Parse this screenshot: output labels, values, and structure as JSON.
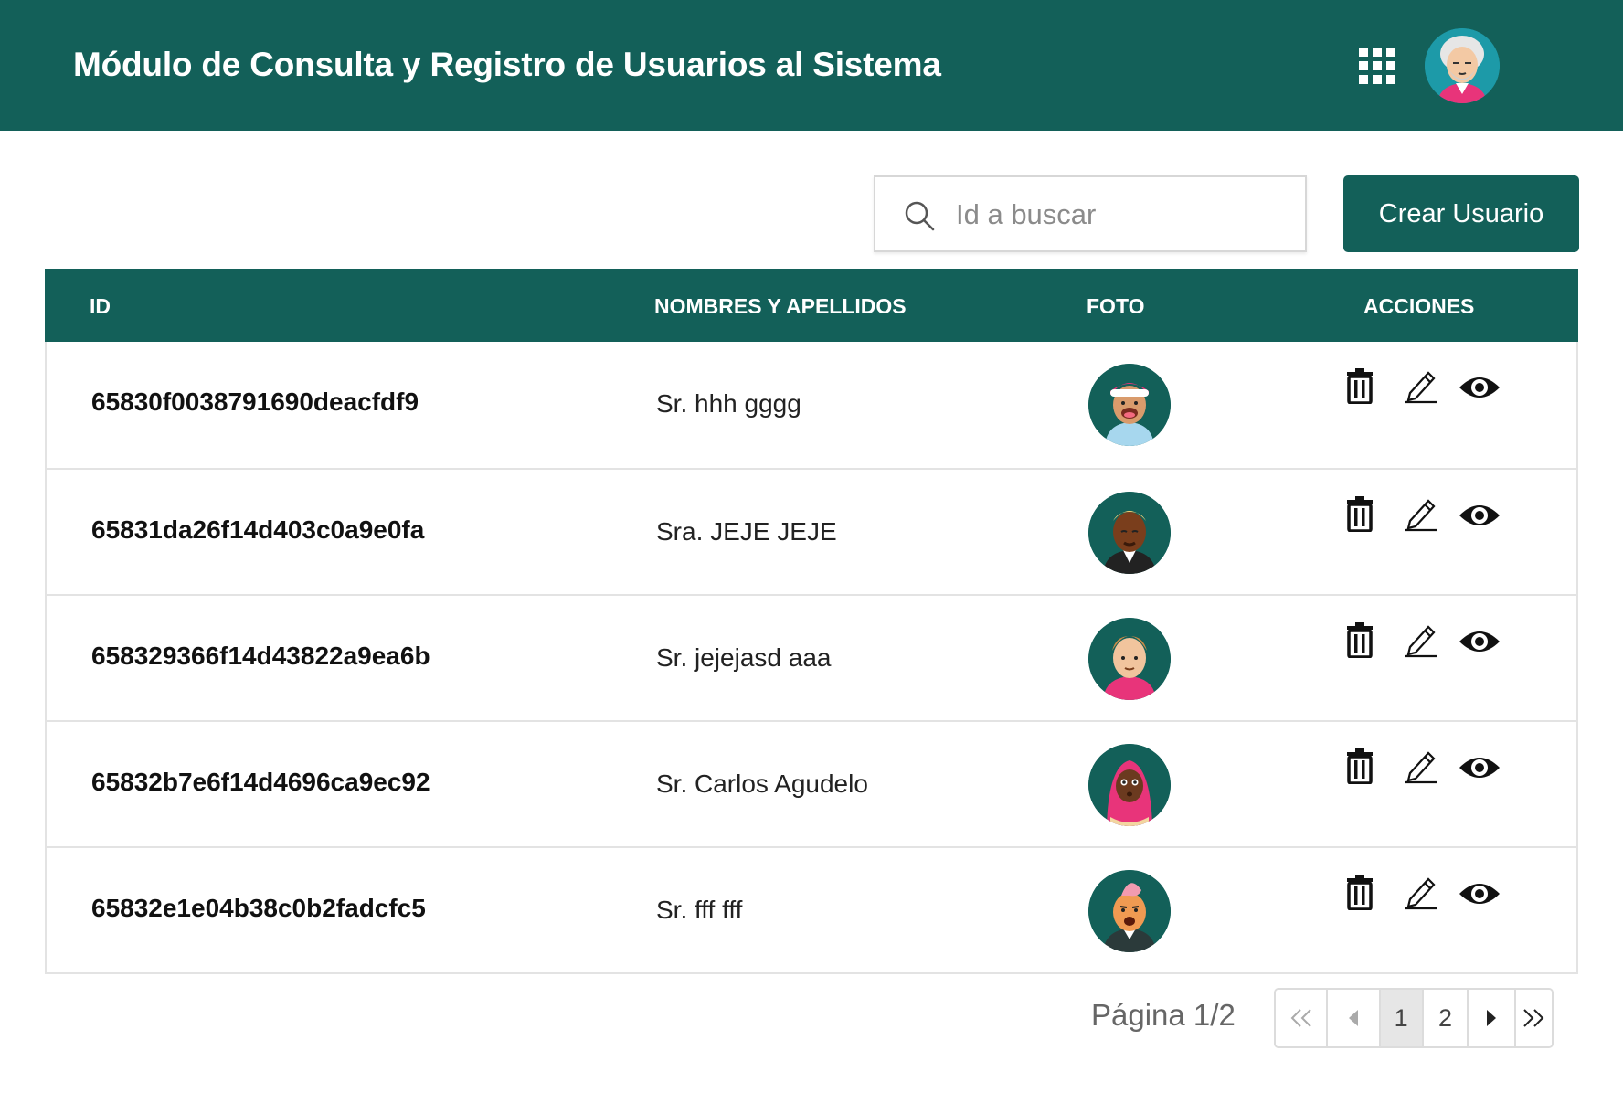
{
  "header": {
    "title": "Módulo de Consulta y Registro de Usuarios al Sistema",
    "apps_icon": "grid-apps-icon",
    "user_avatar": "user-avatar"
  },
  "search": {
    "placeholder": "Id a buscar",
    "value": "",
    "icon": "search-icon"
  },
  "create_button": {
    "label": "Crear Usuario"
  },
  "table": {
    "columns": [
      "ID",
      "NOMBRES Y APELLIDOS",
      "FOTO",
      "ACCIONES"
    ],
    "rows": [
      {
        "id": "65830f003879169 0deacfdf9",
        "name": "Sr. hhh gggg",
        "avatar": "avatar-boy-pink-cap"
      },
      {
        "id": "65831da26f14d403c0a9e0fa",
        "name": "Sra. JEJE JEJE",
        "avatar": "avatar-man-dark-skin"
      },
      {
        "id": "658329366f14d43822a9ea6b",
        "name": "Sr. jejejasd aaa",
        "avatar": "avatar-man-blond"
      },
      {
        "id": "65832b7e6f14d4696ca9ec92",
        "name": "Sr. Carlos Agudelo",
        "avatar": "avatar-woman-hijab"
      },
      {
        "id": "65832e1e04b38c0b2fadcfc5",
        "name": "Sr. fff fff",
        "avatar": "avatar-man-orange-hair"
      }
    ],
    "actions": [
      "trash-icon",
      "pencil-icon",
      "eye-icon"
    ]
  },
  "pagination": {
    "label": "Página 1/2",
    "first": "<<",
    "pages": [
      "1",
      "2"
    ],
    "current": "1",
    "last": ">>"
  },
  "colors": {
    "primary": "#136059",
    "border": "#e3e3e3"
  }
}
